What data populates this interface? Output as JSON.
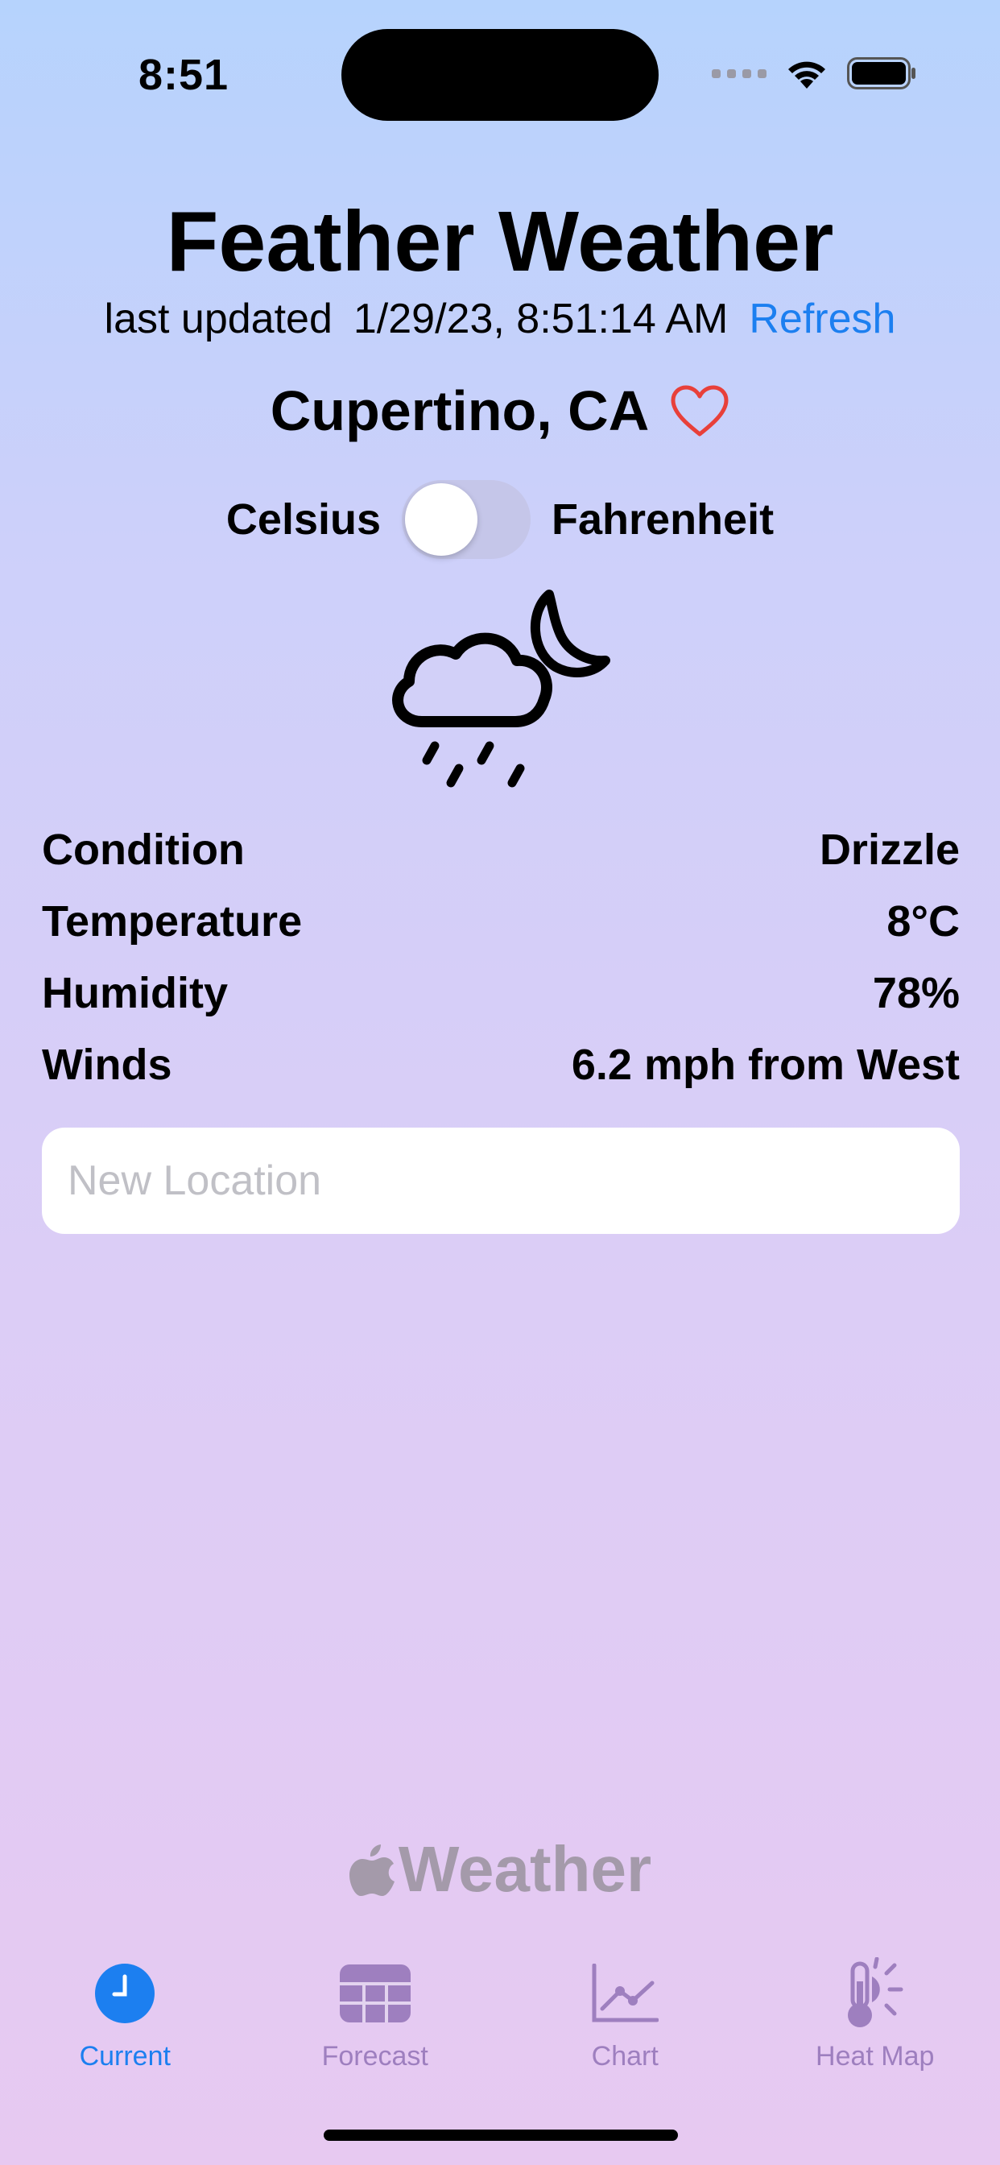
{
  "status_bar": {
    "time": "8:51"
  },
  "header": {
    "title": "Feather Weather",
    "last_updated_label": "last updated",
    "last_updated_value": "1/29/23, 8:51:14 AM",
    "refresh_label": "Refresh"
  },
  "location": {
    "name": "Cupertino, CA",
    "favorite": false
  },
  "units": {
    "left_label": "Celsius",
    "right_label": "Fahrenheit",
    "fahrenheit_enabled": false
  },
  "weather_icon": "cloud-moon-rain-icon",
  "details": [
    {
      "label": "Condition",
      "value": "Drizzle"
    },
    {
      "label": "Temperature",
      "value": "8°C"
    },
    {
      "label": "Humidity",
      "value": "78%"
    },
    {
      "label": "Winds",
      "value": "6.2 mph from West"
    }
  ],
  "search": {
    "placeholder": "New Location",
    "value": ""
  },
  "attribution": {
    "brand": "Weather"
  },
  "tabs": [
    {
      "label": "Current",
      "icon": "clock-icon",
      "active": true
    },
    {
      "label": "Forecast",
      "icon": "table-icon",
      "active": false
    },
    {
      "label": "Chart",
      "icon": "chart-icon",
      "active": false
    },
    {
      "label": "Heat Map",
      "icon": "thermometer-sun-icon",
      "active": false
    }
  ],
  "colors": {
    "accent": "#1c7ff0",
    "favorite": "#e8403a",
    "tab_inactive": "#9e7fbf"
  }
}
